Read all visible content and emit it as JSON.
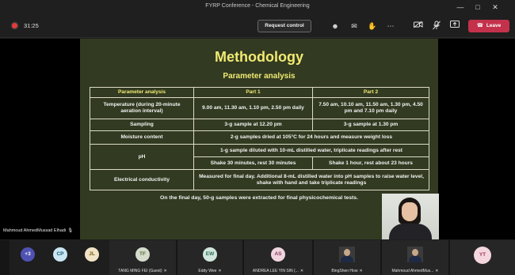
{
  "window": {
    "title": "FYRP Conference - Chemical Engineering",
    "controls": [
      "minimize-icon",
      "maximize-icon",
      "close-icon"
    ]
  },
  "toolbar": {
    "timer": "31:25",
    "request_control_label": "Request control",
    "icons": [
      "people-icon",
      "chat-icon",
      "raise-hand-icon",
      "more-icon",
      "camera-off-icon",
      "mic-off-icon",
      "share-screen-icon"
    ],
    "leave_label": "Leave",
    "colors": {
      "leave": "#c4314b",
      "recording": "#e23b3b"
    }
  },
  "slide": {
    "title": "Methodology",
    "subtitle": "Parameter analysis",
    "title_color": "#f1ea73",
    "background": "#323a21",
    "table": {
      "headers": [
        "Parameter analysis",
        "Part 1",
        "Part 2"
      ],
      "rows": {
        "temperature": {
          "label": "Temperature (during 20-minute aeration interval)",
          "part1": "9.00 am, 11.30 am, 1.10 pm, 2.50 pm daily",
          "part2": "7.50 am, 10.10 am, 11.50 am, 1.30 pm, 4.50 pm and 7.10 pm daily"
        },
        "sampling": {
          "label": "Sampling",
          "part1": "3-g sample at 12.20 pm",
          "part2": "3-g sample at 1.30 pm"
        },
        "moisture": {
          "label": "Moisture content",
          "merged": "2-g samples dried at 105°C for 24 hours and measure weight loss"
        },
        "ph": {
          "label": "pH",
          "merged": "1-g sample diluted with 10-mL distilled water, triplicate readings after rest",
          "part1": "Shake 30 minutes, rest 30 minutes",
          "part2": "Shake 1 hour, rest about 23 hours"
        },
        "electrical": {
          "label": "Electrical conductivity",
          "merged": "Measured for final day. Additional 8-mL distilled water into pH samples to raise water level, shake with hand and take triplicate readings"
        }
      }
    },
    "note": "On the final day, 50-g samples were extracted for final physicochemical tests."
  },
  "presenter": {
    "name": "Mahmoud AhmedMussad Elhadi"
  },
  "participants": [
    {
      "initials": "+3",
      "name": "",
      "color": "#4f52b2",
      "text_color": "#ffffff"
    },
    {
      "initials": "CP",
      "name": "",
      "color": "#c9e6f2",
      "text_color": "#1b5a72"
    },
    {
      "initials": "JL",
      "name": "",
      "color": "#f2e3c6",
      "text_color": "#7a5a1a"
    },
    {
      "initials": "TF",
      "name": "TANG MING FEI (Guest)",
      "color": "#d6dccb",
      "text_color": "#5a6b3d"
    },
    {
      "initials": "EW",
      "name": "Eddy Wee",
      "color": "#cfe6dc",
      "text_color": "#2f6e55"
    },
    {
      "initials": "AS",
      "name": "ANDREA LEE YIN SIN (...",
      "color": "#f0d5df",
      "text_color": "#8a3a5c"
    },
    {
      "initials": "",
      "name": "BingShen How",
      "photo": true
    },
    {
      "initials": "",
      "name": "Mahmoud AhmedMus...",
      "photo": true
    },
    {
      "initials": "YT",
      "name": "",
      "color": "#f4d6de",
      "text_color": "#a23b5e"
    }
  ]
}
